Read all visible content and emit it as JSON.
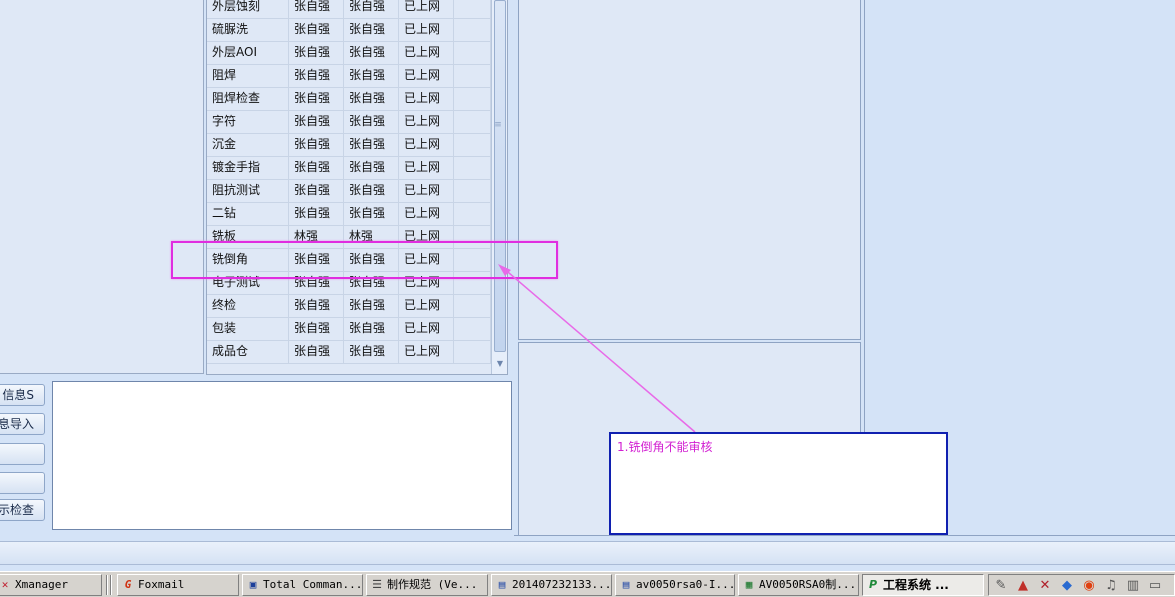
{
  "table": {
    "rows": [
      {
        "process": "外层蚀刻",
        "operator": "张自强",
        "reviewer": "张自强",
        "status": "已上网",
        "extra": ""
      },
      {
        "process": "硫脲洗",
        "operator": "张自强",
        "reviewer": "张自强",
        "status": "已上网",
        "extra": ""
      },
      {
        "process": "外层AOI",
        "operator": "张自强",
        "reviewer": "张自强",
        "status": "已上网",
        "extra": ""
      },
      {
        "process": "阻焊",
        "operator": "张自强",
        "reviewer": "张自强",
        "status": "已上网",
        "extra": ""
      },
      {
        "process": "阻焊检查",
        "operator": "张自强",
        "reviewer": "张自强",
        "status": "已上网",
        "extra": ""
      },
      {
        "process": "字符",
        "operator": "张自强",
        "reviewer": "张自强",
        "status": "已上网",
        "extra": ""
      },
      {
        "process": "沉金",
        "operator": "张自强",
        "reviewer": "张自强",
        "status": "已上网",
        "extra": ""
      },
      {
        "process": "镀金手指",
        "operator": "张自强",
        "reviewer": "张自强",
        "status": "已上网",
        "extra": ""
      },
      {
        "process": "阻抗测试",
        "operator": "张自强",
        "reviewer": "张自强",
        "status": "已上网",
        "extra": ""
      },
      {
        "process": "二钻",
        "operator": "张自强",
        "reviewer": "张自强",
        "status": "已上网",
        "extra": ""
      },
      {
        "process": "铣板",
        "operator": "林强",
        "reviewer": "林强",
        "status": "已上网",
        "extra": ""
      },
      {
        "process": "铣倒角",
        "operator": "张自强",
        "reviewer": "张自强",
        "status": "已上网",
        "extra": ""
      },
      {
        "process": "电子测试",
        "operator": "张自强",
        "reviewer": "张自强",
        "status": "已上网",
        "extra": ""
      },
      {
        "process": "终检",
        "operator": "张自强",
        "reviewer": "张自强",
        "status": "已上网",
        "extra": ""
      },
      {
        "process": "包装",
        "operator": "张自强",
        "reviewer": "张自强",
        "status": "已上网",
        "extra": ""
      },
      {
        "process": "成品仓",
        "operator": "张自强",
        "reviewer": "张自强",
        "status": "已上网",
        "extra": ""
      }
    ]
  },
  "side_buttons": [
    {
      "label": "信息S"
    },
    {
      "label": "息导入"
    },
    {
      "label": ""
    },
    {
      "label": ""
    },
    {
      "label": "示检查"
    }
  ],
  "annotation": {
    "note": "1.铣倒角不能审核"
  },
  "taskbar": {
    "tasks": [
      {
        "label": "Xmanager",
        "icon": "x-icon"
      },
      {
        "label": "Foxmail",
        "icon": "foxmail-icon"
      },
      {
        "label": "Total Comman...",
        "icon": "floppy-icon"
      },
      {
        "label": "制作规范 (Ve...",
        "icon": "document-icon"
      },
      {
        "label": "201407232133...",
        "icon": "word-icon"
      },
      {
        "label": "av0050rsa0-I...",
        "icon": "word-icon"
      },
      {
        "label": "AV0050RSA0制...",
        "icon": "excel-icon"
      },
      {
        "label": "工程系统   ...",
        "icon": "app-icon"
      }
    ]
  },
  "colors": {
    "highlight": "#e02ee0",
    "note_border": "#1020b0",
    "note_text": "#d21fd2"
  }
}
